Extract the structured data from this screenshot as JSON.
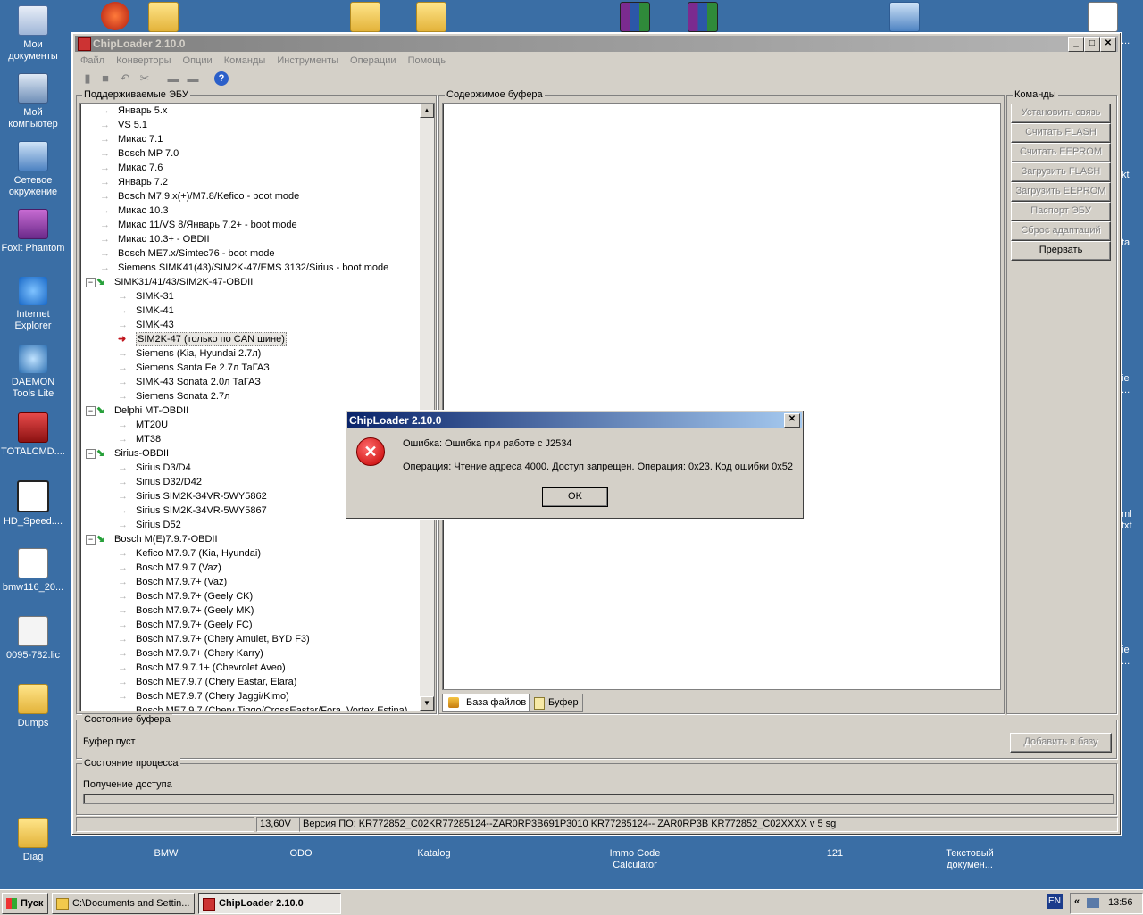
{
  "desktop": {
    "left_icons": [
      {
        "label": "Мои документы",
        "icon": "my-documents-icon"
      },
      {
        "label": "Мой компьютер",
        "icon": "my-computer-icon"
      },
      {
        "label": "Сетевое окружение",
        "icon": "network-icon"
      },
      {
        "label": "Foxit Phantom",
        "icon": "foxit-icon"
      },
      {
        "label": "Internet Explorer",
        "icon": "ie-icon"
      },
      {
        "label": "DAEMON Tools Lite",
        "icon": "daemon-icon"
      },
      {
        "label": "TOTALCMD....",
        "icon": "totalcmd-icon"
      },
      {
        "label": "HD_Speed....",
        "icon": "hdspeed-icon"
      },
      {
        "label": "bmw116_20...",
        "icon": "file-icon"
      },
      {
        "label": "0095-782.lic",
        "icon": "license-file-icon"
      },
      {
        "label": "Dumps",
        "icon": "folder-icon"
      },
      {
        "label": "Diag",
        "icon": "folder-icon"
      }
    ],
    "bottom_icons": [
      {
        "label": "BMW",
        "icon": "folder-icon"
      },
      {
        "label": "ODO",
        "icon": "folder-icon"
      },
      {
        "label": "Katalog",
        "icon": "folder-icon"
      },
      {
        "label": "Immo Code Calculator",
        "icon": "app-icon"
      },
      {
        "label": "121",
        "icon": "folder-icon"
      },
      {
        "label": "Текстовый докумен...",
        "icon": "text-file-icon"
      }
    ],
    "right_edge_fragments": [
      "kt",
      "ta",
      "ie",
      "...",
      "ml",
      "txt",
      "ie",
      "..."
    ]
  },
  "window": {
    "title": "ChipLoader 2.10.0",
    "menu": [
      "Файл",
      "Конверторы",
      "Опции",
      "Команды",
      "Инструменты",
      "Операции",
      "Помощь"
    ],
    "ecu_panel": {
      "title": "Поддерживаемые ЭБУ",
      "items": [
        {
          "label": "Январь 5.x",
          "level": 1
        },
        {
          "label": "VS 5.1",
          "level": 1
        },
        {
          "label": "Микас 7.1",
          "level": 1
        },
        {
          "label": "Bosch MP 7.0",
          "level": 1
        },
        {
          "label": "Микас 7.6",
          "level": 1
        },
        {
          "label": "Январь 7.2",
          "level": 1
        },
        {
          "label": "Bosch M7.9.x(+)/M7.8/Kefico - boot mode",
          "level": 1
        },
        {
          "label": "Микас 10.3",
          "level": 1
        },
        {
          "label": "Микас 11/VS 8/Январь 7.2+ - boot mode",
          "level": 1
        },
        {
          "label": "Микас 10.3+ - OBDII",
          "level": 1
        },
        {
          "label": "Bosch ME7.x/Simtec76 - boot mode",
          "level": 1
        },
        {
          "label": "Siemens SIMK41(43)/SIM2K-47/EMS 3132/Sirius - boot mode",
          "level": 1
        },
        {
          "label": "SIMK31/41/43/SIM2K-47-OBDII",
          "level": 0
        },
        {
          "label": "SIMK-31",
          "level": 2
        },
        {
          "label": "SIMK-41",
          "level": 2
        },
        {
          "label": "SIMK-43",
          "level": 2
        },
        {
          "label": "SIM2K-47 (только по CAN шине)",
          "level": 2,
          "selected": true
        },
        {
          "label": "Siemens (Kia, Hyundai 2.7л)",
          "level": 2
        },
        {
          "label": "Siemens Santa Fe 2.7л ТаГАЗ",
          "level": 2
        },
        {
          "label": "SIMK-43 Sonata 2.0л ТаГАЗ",
          "level": 2
        },
        {
          "label": "Siemens Sonata 2.7л",
          "level": 2
        },
        {
          "label": "Delphi MT-OBDII",
          "level": 0
        },
        {
          "label": "MT20U",
          "level": 2
        },
        {
          "label": "MT38",
          "level": 2
        },
        {
          "label": "Sirius-OBDII",
          "level": 0
        },
        {
          "label": "Sirius D3/D4",
          "level": 2
        },
        {
          "label": "Sirius D32/D42",
          "level": 2
        },
        {
          "label": "Sirius SIM2K-34VR-5WY5862",
          "level": 2
        },
        {
          "label": "Sirius SIM2K-34VR-5WY5867",
          "level": 2
        },
        {
          "label": "Sirius D52",
          "level": 2
        },
        {
          "label": "Bosch M(E)7.9.7-OBDII",
          "level": 0
        },
        {
          "label": "Kefico M7.9.7 (Kia, Hyundai)",
          "level": 2
        },
        {
          "label": "Bosch M7.9.7 (Vaz)",
          "level": 2
        },
        {
          "label": "Bosch M7.9.7+ (Vaz)",
          "level": 2
        },
        {
          "label": "Bosch M7.9.7+ (Geely CK)",
          "level": 2
        },
        {
          "label": "Bosch M7.9.7+ (Geely MK)",
          "level": 2
        },
        {
          "label": "Bosch M7.9.7+ (Geely FC)",
          "level": 2
        },
        {
          "label": "Bosch M7.9.7+ (Chery Amulet, BYD F3)",
          "level": 2
        },
        {
          "label": "Bosch M7.9.7+ (Chery Karry)",
          "level": 2
        },
        {
          "label": "Bosch M7.9.7.1+ (Chevrolet Aveo)",
          "level": 2
        },
        {
          "label": "Bosch ME7.9.7 (Chery Eastar, Elara)",
          "level": 2
        },
        {
          "label": "Bosch ME7.9.7 (Chery Jaggi/Kimo)",
          "level": 2
        },
        {
          "label": "Bosch ME7.9.7 (Chery Tiggo/CrossEastar/Fora, Vortex Estina)",
          "level": 2
        }
      ]
    },
    "buffer_panel": {
      "title": "Содержимое буфера",
      "tabs": [
        "База файлов",
        "Буфер"
      ]
    },
    "commands_panel": {
      "title": "Команды",
      "buttons": [
        {
          "label": "Установить связь",
          "enabled": false
        },
        {
          "label": "Считать FLASH",
          "enabled": false
        },
        {
          "label": "Считать EEPROM",
          "enabled": false
        },
        {
          "label": "Загрузить FLASH",
          "enabled": false
        },
        {
          "label": "Загрузить EEPROM",
          "enabled": false
        },
        {
          "label": "Паспорт ЭБУ",
          "enabled": false
        },
        {
          "label": "Сброс адаптаций",
          "enabled": false
        },
        {
          "label": "Прервать",
          "enabled": true
        }
      ]
    },
    "buffer_state": {
      "title": "Состояние буфера",
      "text": "Буфер пуст",
      "add_button": "Добавить в базу"
    },
    "process_state": {
      "title": "Состояние процесса",
      "text": "Получение доступа",
      "progress": 0
    },
    "status_bar": {
      "voltage": "13,60V",
      "version": "Версия ПО:  KR772852_C02KR77285124--ZAR0RP3B691P3010 KR77285124-- ZAR0RP3B KR772852_C02XXXX v 5 sg"
    }
  },
  "dialog": {
    "title": "ChipLoader 2.10.0",
    "line1": "Ошибка: Ошибка при работе с J2534",
    "line2": "Операция: Чтение адреса 4000. Доступ запрещен. Операция: 0x23. Код ошибки 0x52",
    "ok_label": "OK"
  },
  "taskbar": {
    "start_label": "Пуск",
    "tasks": [
      {
        "label": "C:\\Documents and Settin...",
        "active": false
      },
      {
        "label": "ChipLoader 2.10.0",
        "active": true
      }
    ],
    "lang": "EN",
    "time": "13:56"
  },
  "colors": {
    "desktop": "#3a6ea5",
    "dialog_title": "#0a246a",
    "selection_arrow": "#c0141c",
    "tree_arrow_green": "#27a03a"
  }
}
